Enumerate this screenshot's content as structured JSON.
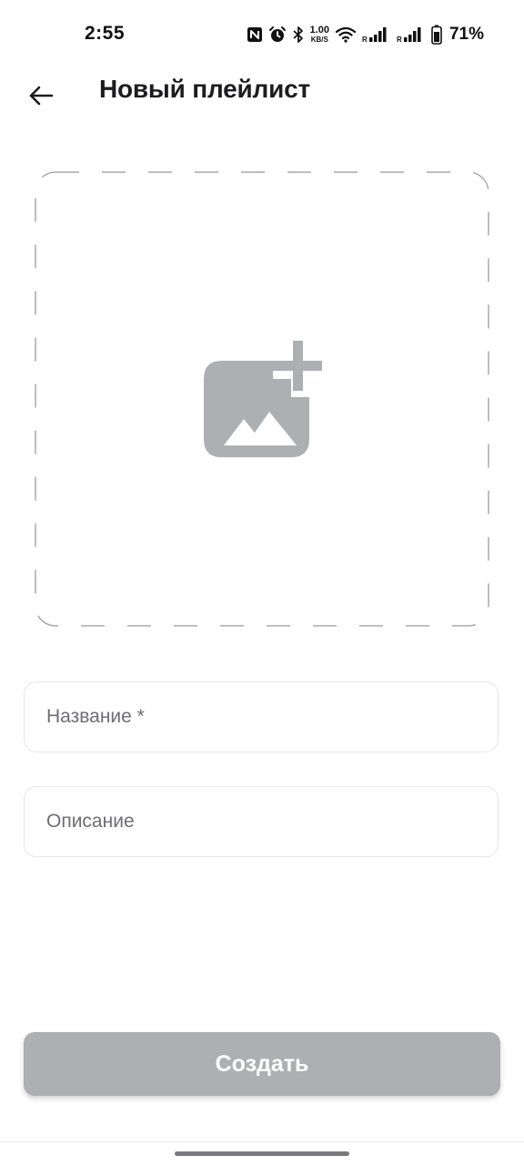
{
  "status_bar": {
    "time": "2:55",
    "net_speed_value": "1.00",
    "net_speed_unit": "KB/S",
    "battery_percent": "71%",
    "icons": [
      "nfc-icon",
      "alarm-icon",
      "bluetooth-icon",
      "wifi-icon",
      "signal-icon",
      "signal-icon",
      "battery-icon"
    ]
  },
  "header": {
    "title": "Новый плейлист",
    "back_icon": "arrow-left-icon"
  },
  "cover": {
    "icon": "add-image-icon"
  },
  "form": {
    "name_placeholder": "Название *",
    "description_placeholder": "Описание"
  },
  "actions": {
    "create_label": "Создать"
  },
  "colors": {
    "button_disabled": "#aeafb3",
    "icon_gray": "#aeafb3",
    "text_primary": "#1d1d1f",
    "placeholder": "#6e6e73"
  }
}
